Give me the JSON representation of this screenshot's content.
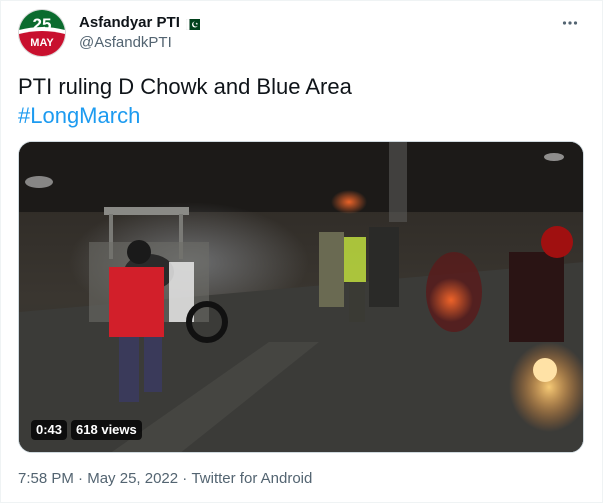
{
  "tweet": {
    "display_name": "Asfandyar PTI",
    "handle": "@AsfandkPTI",
    "avatar_text_top": "25",
    "avatar_text_bottom": "MAY",
    "text_line": "PTI ruling D Chowk and Blue Area",
    "hashtag": "#LongMarch",
    "video": {
      "duration": "0:43",
      "views": "618 views"
    },
    "time": "7:58 PM",
    "separator": " · ",
    "date": "May 25, 2022",
    "source": "Twitter for Android"
  },
  "icons": {
    "flag": "pakistan-flag-icon",
    "more": "more-options-icon"
  },
  "colors": {
    "link": "#1d9bf0",
    "text": "#0f1419",
    "secondary": "#536471",
    "flag_green": "#01411c",
    "avatar_red": "#c8102e",
    "avatar_green": "#0b6b2e"
  }
}
